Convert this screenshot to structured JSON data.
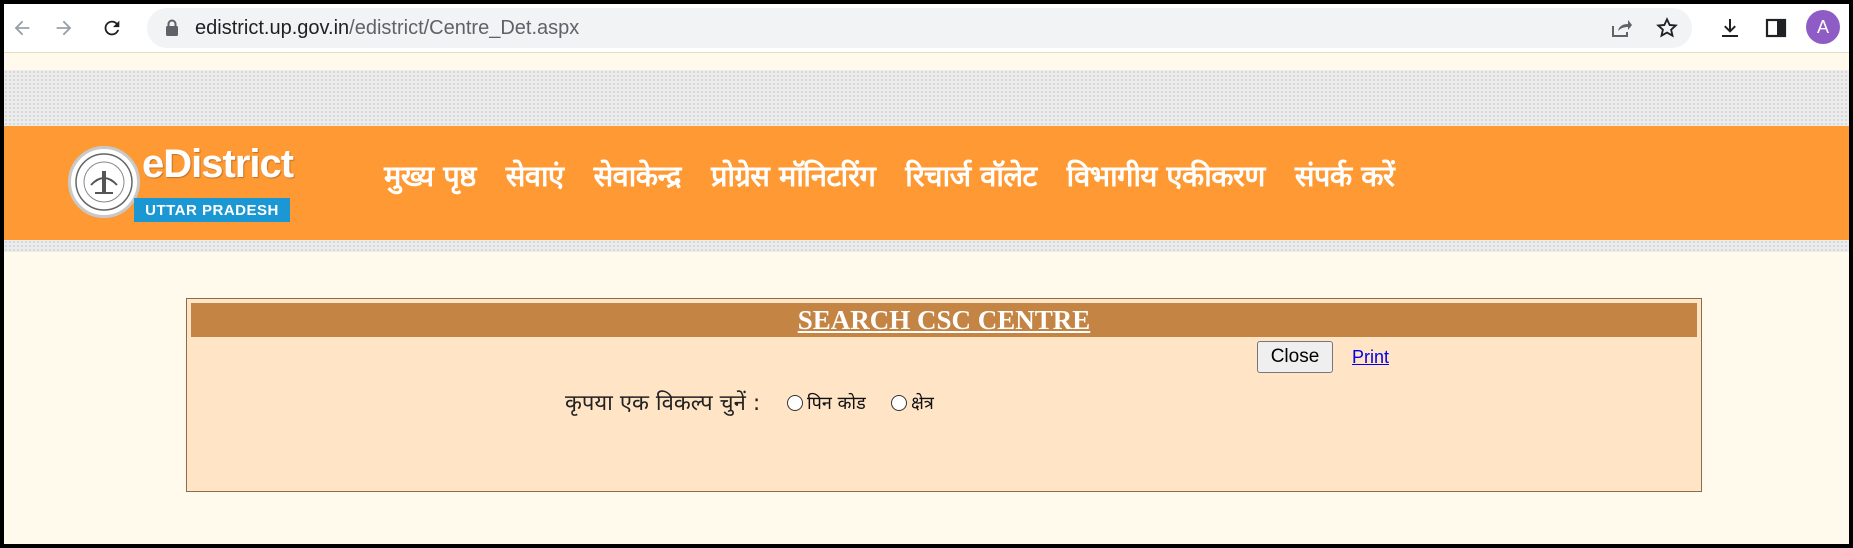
{
  "browser": {
    "url_domain": "edistrict.up.gov.in",
    "url_path": "/edistrict/Centre_Det.aspx",
    "avatar_letter": "A"
  },
  "header": {
    "brand": "eDistrict",
    "state": "UTTAR PRADESH",
    "menu": [
      "मुख्य पृष्ठ",
      "सेवाएं",
      "सेवाकेन्द्र",
      "प्रोग्रेस मॉनिटरिंग",
      "रिचार्ज वॉलेट",
      "विभागीय एकीकरण",
      "संपर्क करें"
    ]
  },
  "panel": {
    "title": "SEARCH CSC CENTRE",
    "close_label": "Close",
    "print_label": "Print",
    "choose_label": "कृपया एक विकल्प चुनें :",
    "options": [
      "पिन कोड",
      "क्षेत्र"
    ]
  },
  "colors": {
    "orange_band": "#ff9933",
    "panel_bg": "#ffe5c6",
    "panel_title_bg": "#c38444",
    "page_bg": "#fffaec",
    "state_badge": "#1b98d4"
  },
  "icons": [
    "back-arrow-icon",
    "forward-arrow-icon",
    "reload-icon",
    "lock-icon",
    "share-icon",
    "star-icon",
    "download-icon",
    "side-panel-icon"
  ]
}
